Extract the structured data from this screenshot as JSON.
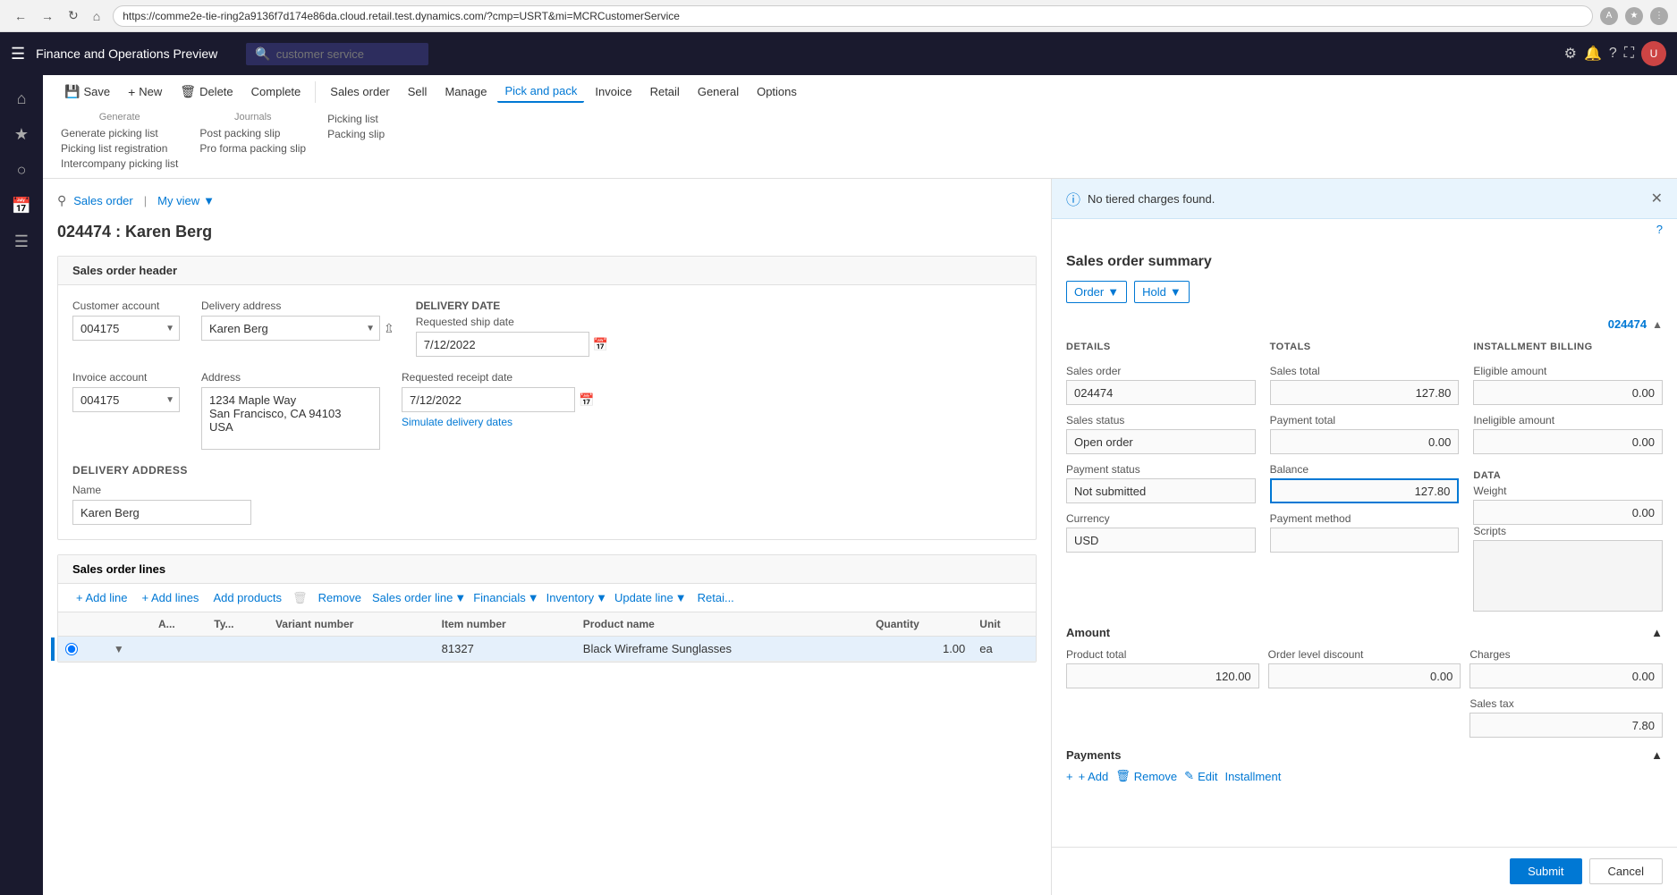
{
  "browser": {
    "url": "https://comme2e-tie-ring2a9136f7d174e86da.cloud.retail.test.dynamics.com/?cmp=USRT&mi=MCRCustomerService",
    "search_placeholder": "customer service"
  },
  "app": {
    "title": "Finance and Operations Preview"
  },
  "ribbon": {
    "tabs": [
      "Save",
      "New",
      "Delete",
      "Complete",
      "Sales order",
      "Sell",
      "Manage",
      "Pick and pack",
      "Invoice",
      "Retail",
      "General",
      "Options"
    ],
    "active_tab": "Pick and pack",
    "generate_label": "Generate",
    "journals_label": "Journals",
    "generate_items": [
      "Generate picking list",
      "Picking list registration",
      "Intercompany picking list"
    ],
    "journals_items": [
      "Post packing slip",
      "Pro forma packing slip"
    ],
    "picking_list_label": "Picking list",
    "packing_slip_label": "Packing slip"
  },
  "page": {
    "breadcrumb": "Sales order",
    "view": "My view",
    "title": "024474 : Karen Berg"
  },
  "header_section": {
    "label": "Sales order header",
    "customer_account_label": "Customer account",
    "customer_account_value": "004175",
    "invoice_account_label": "Invoice account",
    "invoice_account_value": "004175",
    "delivery_address_label": "Delivery address",
    "delivery_address_value": "Karen Berg",
    "address_label": "Address",
    "address_value": "1234 Maple Way\nSan Francisco, CA 94103\nUSA",
    "delivery_date_label": "DELIVERY DATE",
    "requested_ship_date_label": "Requested ship date",
    "requested_ship_date_value": "7/12/2022",
    "requested_receipt_date_label": "Requested receipt date",
    "requested_receipt_date_value": "7/12/2022",
    "simulate_link": "Simulate delivery dates",
    "delivery_address_section_label": "DELIVERY ADDRESS",
    "delivery_name_label": "Name",
    "delivery_name_value": "Karen Berg"
  },
  "lines_section": {
    "label": "Sales order lines",
    "toolbar": {
      "add_line": "+ Add line",
      "add_lines": "+ Add lines",
      "add_products": "Add products",
      "remove": "Remove",
      "sales_order_line": "Sales order line",
      "financials": "Financials",
      "inventory": "Inventory",
      "update_line": "Update line",
      "retail": "Retai..."
    },
    "columns": [
      "",
      "",
      "A...",
      "Ty...",
      "Variant number",
      "Item number",
      "Product name",
      "Quantity",
      "Unit"
    ],
    "rows": [
      {
        "item_number": "81327",
        "product_name": "Black Wireframe Sunglasses",
        "quantity": "1.00",
        "unit": "ea"
      }
    ]
  },
  "panel": {
    "notification": "No tiered charges found.",
    "title": "Sales order summary",
    "order_btn": "Order",
    "hold_btn": "Hold",
    "order_number": "024474",
    "details": {
      "header": "DETAILS",
      "sales_order_label": "Sales order",
      "sales_order_value": "024474",
      "sales_status_label": "Sales status",
      "sales_status_value": "Open order",
      "payment_status_label": "Payment status",
      "payment_status_value": "Not submitted",
      "currency_label": "Currency",
      "currency_value": "USD"
    },
    "totals": {
      "header": "TOTALS",
      "sales_total_label": "Sales total",
      "sales_total_value": "127.80",
      "payment_total_label": "Payment total",
      "payment_total_value": "0.00",
      "balance_label": "Balance",
      "balance_value": "127.80",
      "payment_method_label": "Payment method",
      "payment_method_value": ""
    },
    "installment": {
      "header": "INSTALLMENT BILLING",
      "eligible_label": "Eligible amount",
      "eligible_value": "0.00",
      "ineligible_label": "Ineligible amount",
      "ineligible_value": "0.00"
    },
    "data_section": {
      "header": "DATA",
      "weight_label": "Weight",
      "weight_value": "0.00",
      "scripts_label": "Scripts"
    },
    "amount": {
      "header": "Amount",
      "product_total_label": "Product total",
      "product_total_value": "120.00",
      "order_discount_label": "Order level discount",
      "order_discount_value": "0.00",
      "charges_label": "Charges",
      "charges_value": "0.00",
      "sales_tax_label": "Sales tax",
      "sales_tax_value": "7.80"
    },
    "payments": {
      "header": "Payments",
      "add_btn": "+ Add",
      "remove_btn": "Remove",
      "edit_btn": "Edit",
      "installment_btn": "Installment"
    },
    "footer": {
      "submit_btn": "Submit",
      "cancel_btn": "Cancel"
    }
  }
}
